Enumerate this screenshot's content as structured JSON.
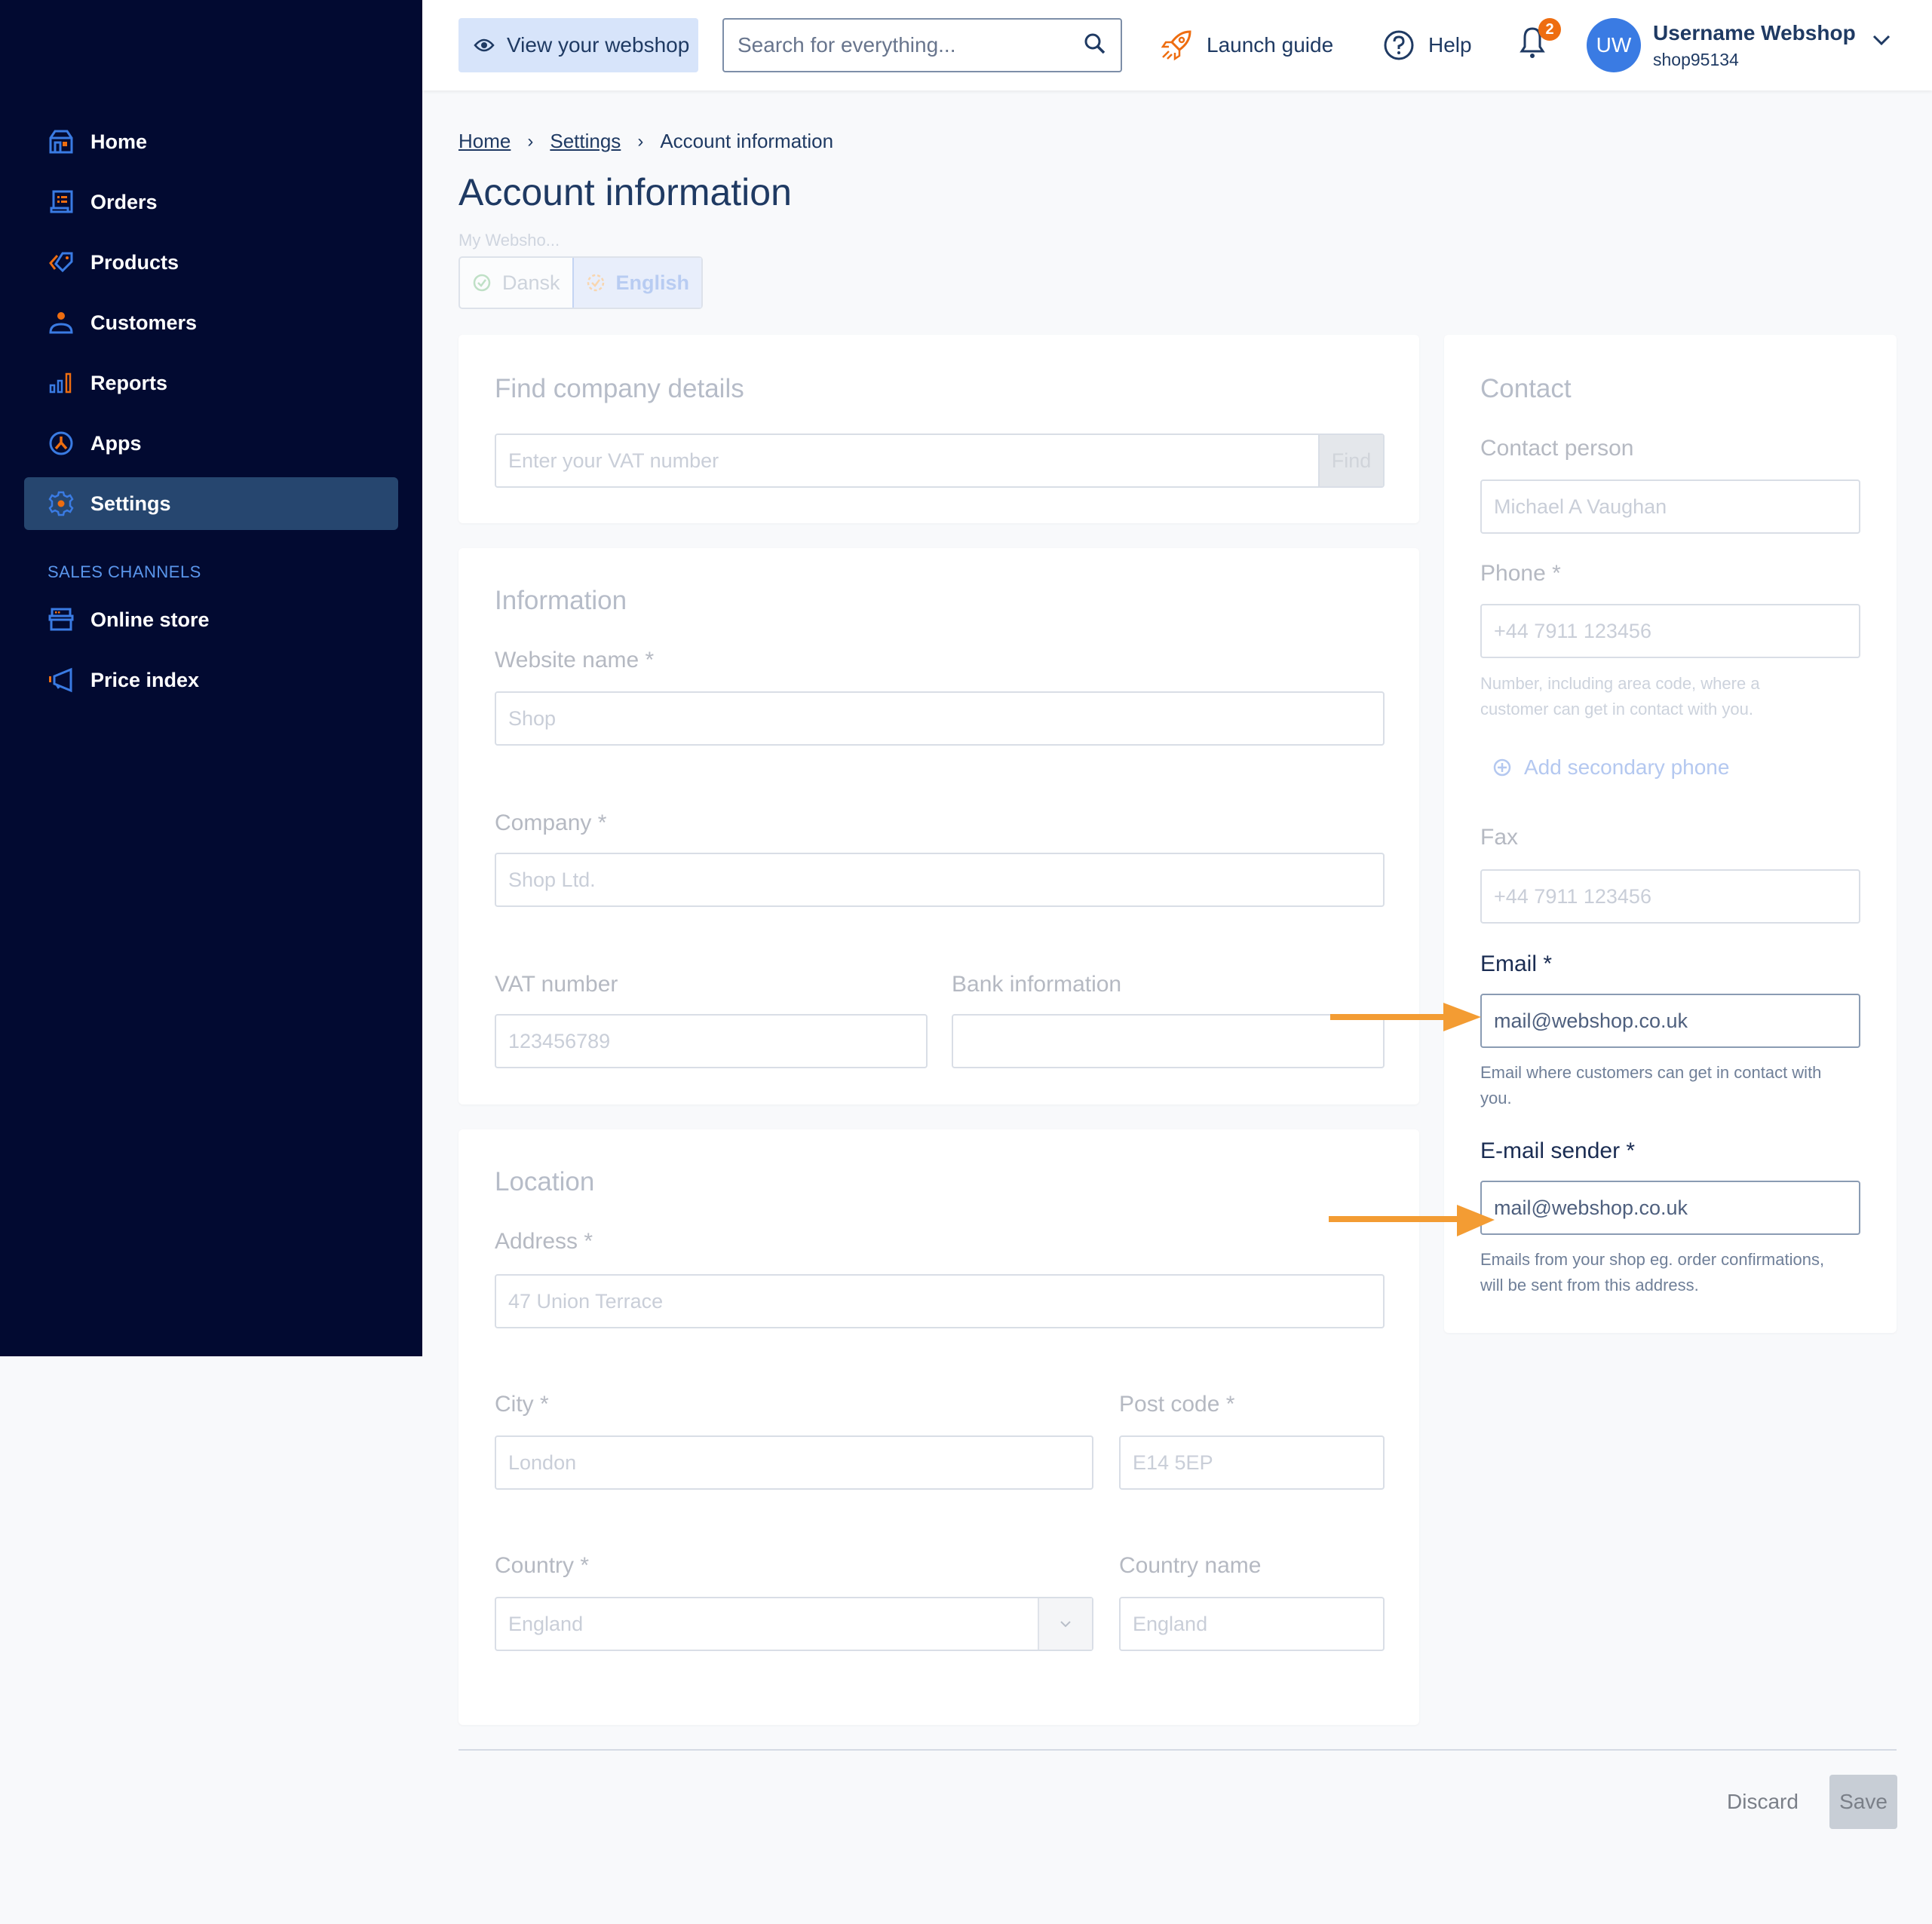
{
  "sidebar": {
    "items": [
      {
        "label": "Home",
        "icon": "home-icon"
      },
      {
        "label": "Orders",
        "icon": "orders-icon"
      },
      {
        "label": "Products",
        "icon": "tag-icon"
      },
      {
        "label": "Customers",
        "icon": "user-icon"
      },
      {
        "label": "Reports",
        "icon": "bar-chart-icon"
      },
      {
        "label": "Apps",
        "icon": "apps-icon"
      },
      {
        "label": "Settings",
        "icon": "gear-icon",
        "active": true
      }
    ],
    "section_title": "SALES CHANNELS",
    "channels": [
      {
        "label": "Online store",
        "icon": "store-icon"
      },
      {
        "label": "Price index",
        "icon": "megaphone-icon"
      }
    ]
  },
  "topbar": {
    "view_webshop": "View your webshop",
    "search_placeholder": "Search for everything...",
    "launch_guide": "Launch guide",
    "help": "Help",
    "notification_count": "2",
    "avatar_initials": "UW",
    "username": "Username Webshop",
    "shop_id": "shop95134"
  },
  "breadcrumb": {
    "items": [
      "Home",
      "Settings"
    ],
    "current": "Account information"
  },
  "page": {
    "title": "Account information",
    "language_caption": "My Websho...",
    "languages": [
      "Dansk",
      "English"
    ],
    "active_language": "English"
  },
  "find_company": {
    "title": "Find company details",
    "vat_placeholder": "Enter your VAT number",
    "find_button": "Find"
  },
  "information": {
    "title": "Information",
    "website_name_label": "Website name *",
    "website_name_value": "Shop",
    "company_label": "Company *",
    "company_value": "Shop Ltd.",
    "vat_label": "VAT number",
    "vat_value": "123456789",
    "bank_label": "Bank information",
    "bank_value": ""
  },
  "location": {
    "title": "Location",
    "address_label": "Address *",
    "address_value": "47 Union Terrace",
    "city_label": "City *",
    "city_value": "London",
    "postcode_label": "Post code *",
    "postcode_value": "E14 5EP",
    "country_label": "Country *",
    "country_value": "England",
    "country_name_label": "Country name",
    "country_name_value": "England"
  },
  "contact": {
    "title": "Contact",
    "person_label": "Contact person",
    "person_value": "Michael A Vaughan",
    "phone_label": "Phone *",
    "phone_value": "+44 7911 123456",
    "phone_help_1": "Number, including area code, where a",
    "phone_help_2": "customer can get in contact with you.",
    "add_secondary_phone": "Add secondary phone",
    "fax_label": "Fax",
    "fax_value": "+44 7911 123456",
    "email_label": "Email *",
    "email_value": "mail@webshop.co.uk",
    "email_help_1": "Email where customers can get in contact with",
    "email_help_2": "you.",
    "sender_label": "E-mail sender *",
    "sender_value": "mail@webshop.co.uk",
    "sender_help_1": "Emails from your shop eg. order confirmations,",
    "sender_help_2": "will be sent from this address."
  },
  "footer": {
    "discard": "Discard",
    "save": "Save"
  },
  "colors": {
    "sidebar_bg": "#020a31",
    "active_nav": "#26466f",
    "accent_blue": "#3a7be3",
    "accent_orange": "#ee6d10",
    "annotation_arrow": "#f39c33"
  }
}
